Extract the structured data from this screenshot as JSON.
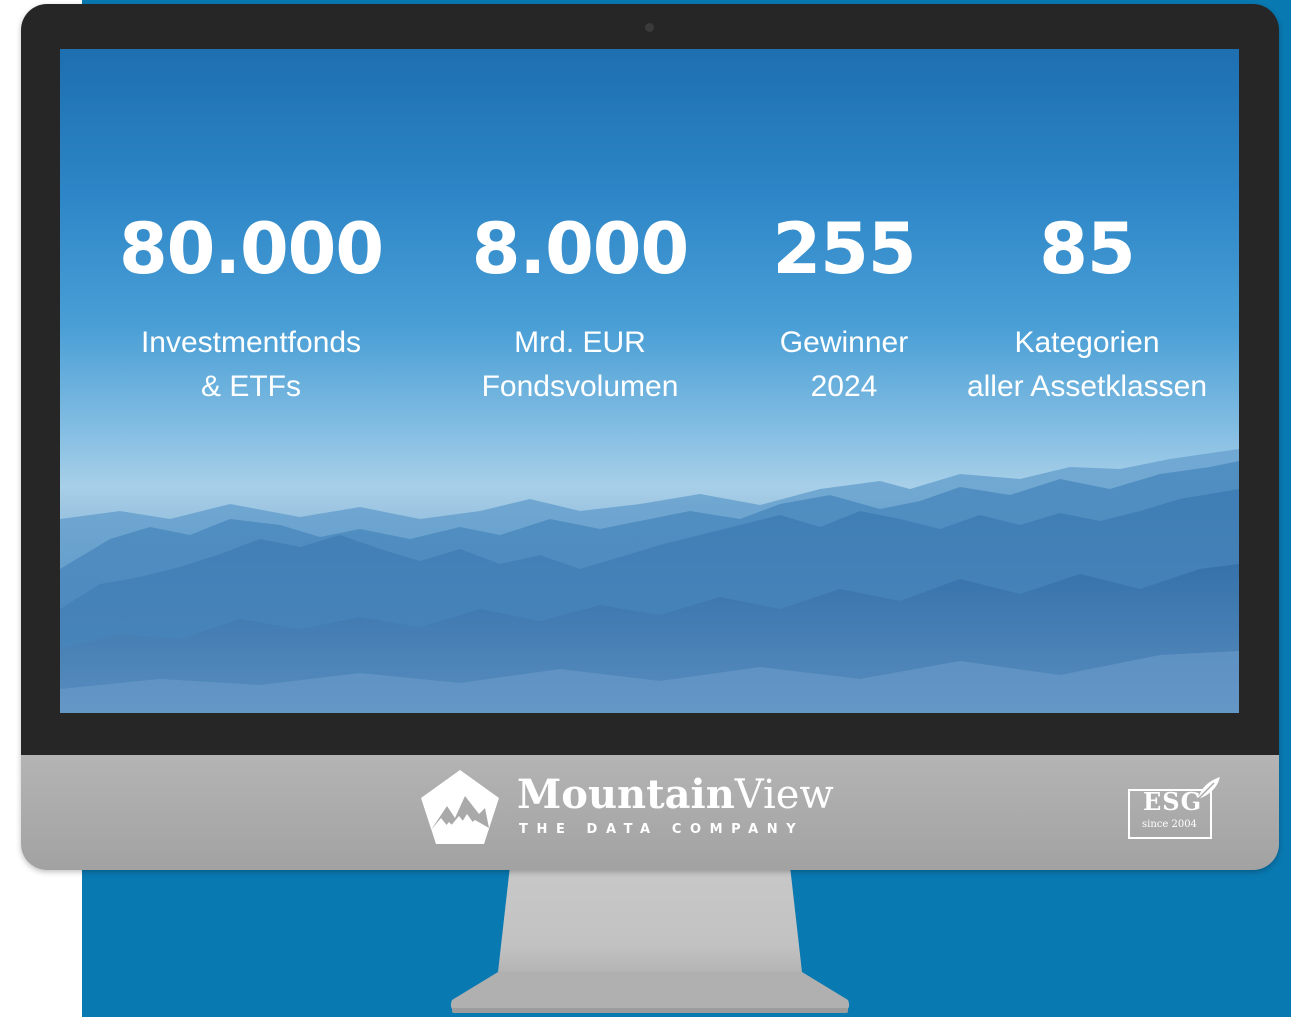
{
  "stats": [
    {
      "number": "80.000",
      "label_line1": "Investmentfonds",
      "label_line2": "& ETFs"
    },
    {
      "number": "8.000",
      "label_line1": "Mrd. EUR",
      "label_line2": "Fondsvolumen"
    },
    {
      "number": "255",
      "label_line1": "Gewinner",
      "label_line2": "2024"
    },
    {
      "number": "85",
      "label_line1": "Kategorien",
      "label_line2": "aller Assetklassen"
    }
  ],
  "logo": {
    "name_bold": "Mountain",
    "name_light": "View",
    "tagline": "THE DATA COMPANY"
  },
  "badge": {
    "main": "ESG",
    "sub": "since 2004"
  },
  "colors": {
    "backdrop": "#0979b1",
    "bezel": "#262626",
    "chin": "#a9a9a9",
    "stand": "#c4c4c4"
  },
  "icons": {
    "logo_mark": "mountain-pentagon-icon",
    "badge_leaf": "leaf-icon"
  }
}
